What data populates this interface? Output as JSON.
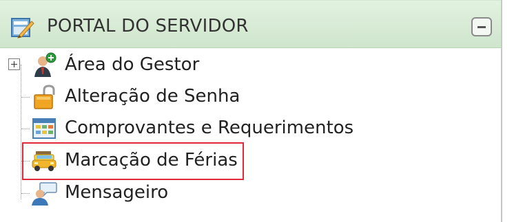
{
  "panel": {
    "title": "PORTAL DO SERVIDOR",
    "collapse_icon": "minus-box-icon",
    "header_icon": "portal-edit-icon"
  },
  "tree": {
    "items": [
      {
        "label": "Área do Gestor",
        "icon": "manager-person-icon",
        "expandable": true,
        "expanded": false
      },
      {
        "label": "Alteração de Senha",
        "icon": "padlock-icon"
      },
      {
        "label": "Comprovantes e Requerimentos",
        "icon": "table-grid-icon"
      },
      {
        "label": "Marcação de Férias",
        "icon": "beach-car-icon",
        "highlighted": true
      },
      {
        "label": "Mensageiro",
        "icon": "messenger-person-icon"
      }
    ]
  },
  "colors": {
    "header_bg": "#d9ecd6",
    "highlight_border": "#e0283a",
    "text": "#222222"
  }
}
